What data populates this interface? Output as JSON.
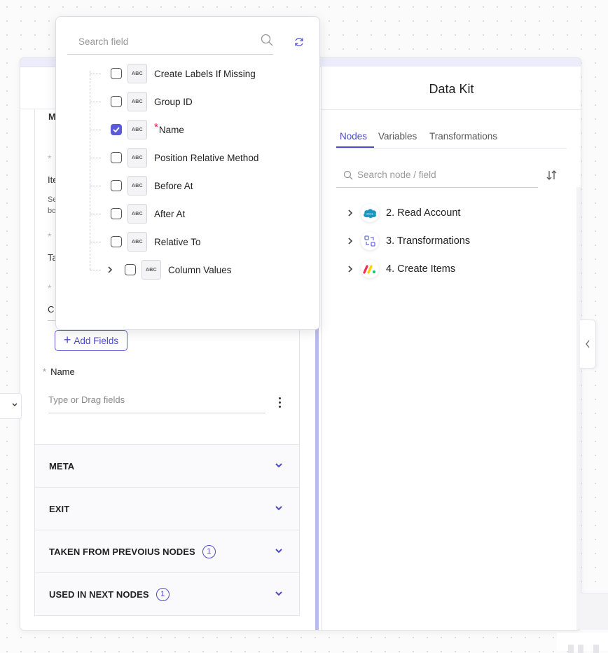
{
  "popup": {
    "search_placeholder": "Search field",
    "fields": [
      {
        "label": "Create Labels If Missing",
        "checked": false,
        "type_badge": "ABC"
      },
      {
        "label": "Group ID",
        "checked": false,
        "type_badge": "ABC"
      },
      {
        "label": "Name",
        "checked": true,
        "required": true,
        "type_badge": "ABC"
      },
      {
        "label": "Position Relative Method",
        "checked": false,
        "type_badge": "ABC"
      },
      {
        "label": "Before At",
        "checked": false,
        "type_badge": "ABC"
      },
      {
        "label": "After At",
        "checked": false,
        "type_badge": "ABC"
      },
      {
        "label": "Relative To",
        "checked": false,
        "type_badge": "ABC"
      },
      {
        "label": "Column Values",
        "checked": false,
        "expandable": true,
        "type_badge": "ABC"
      }
    ],
    "required_mark": "*"
  },
  "left": {
    "partial_texts": [
      "M",
      "*",
      "Ite",
      "Se",
      "bo",
      "*",
      "Ta",
      "*",
      "C"
    ],
    "add_fields_label": "Add Fields",
    "name_field": {
      "label": "Name",
      "required_mark": "*",
      "placeholder": "Type or Drag fields"
    },
    "sections": [
      {
        "title": "META"
      },
      {
        "title": "EXIT"
      },
      {
        "title": "TAKEN FROM PREVOIUS NODES",
        "badge": "1"
      },
      {
        "title": "USED IN NEXT NODES",
        "badge": "1"
      }
    ]
  },
  "right": {
    "title": "Data Kit",
    "tabs": [
      "Nodes",
      "Variables",
      "Transformations"
    ],
    "active_tab": "Nodes",
    "search_placeholder": "Search node / field",
    "nodes": [
      {
        "label": "2. Read Account",
        "icon": "salesforce-icon"
      },
      {
        "label": "3. Transformations",
        "icon": "transform-icon"
      },
      {
        "label": "4. Create Items",
        "icon": "monday-icon"
      }
    ]
  },
  "colors": {
    "accent": "#5b5bd6",
    "required": "#e0103a",
    "divider": "#b9bce8"
  }
}
